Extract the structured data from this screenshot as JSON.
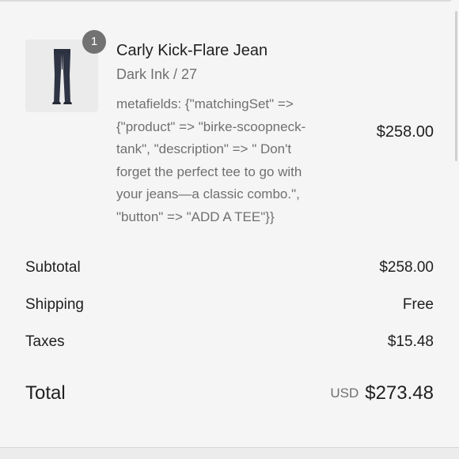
{
  "line_item": {
    "quantity": "1",
    "title": "Carly Kick-Flare Jean",
    "variant": "Dark Ink / 27",
    "metafields": "metafields: {\"matchingSet\" =>\n{\"product\" => \"birke-scoopneck-\ntank\", \"description\" => \" Don't\nforget the perfect tee to go with\nyour jeans—a classic combo.\",\n\"button\" => \"ADD A TEE\"}}",
    "price": "$258.00",
    "image_icon": "jeans-icon"
  },
  "summary": {
    "subtotal_label": "Subtotal",
    "subtotal_value": "$258.00",
    "shipping_label": "Shipping",
    "shipping_value": "Free",
    "taxes_label": "Taxes",
    "taxes_value": "$15.48"
  },
  "total": {
    "label": "Total",
    "currency": "USD",
    "amount": "$273.48"
  },
  "colors": {
    "background": "#f5f5f5",
    "text": "#1f1f1f",
    "muted_text": "#707070",
    "badge": "#727272"
  }
}
